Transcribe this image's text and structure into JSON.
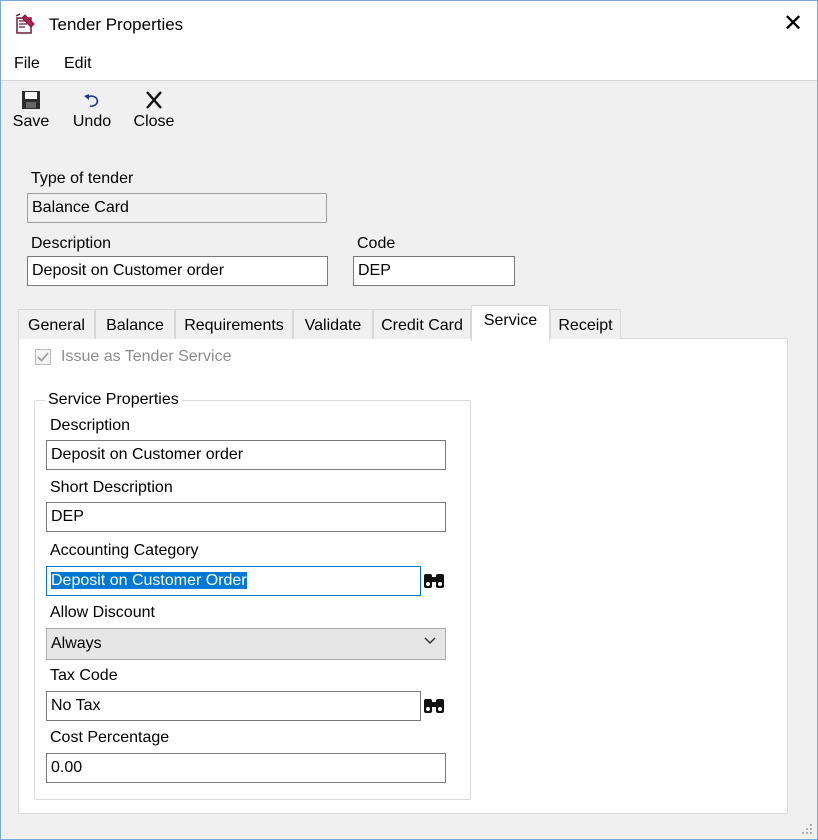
{
  "window": {
    "title": "Tender Properties"
  },
  "menu": {
    "file": "File",
    "edit": "Edit"
  },
  "toolbar": {
    "save": "Save",
    "undo": "Undo",
    "close": "Close"
  },
  "header": {
    "type_label": "Type of tender",
    "type_value": "Balance Card",
    "description_label": "Description",
    "description_value": "Deposit on Customer order",
    "code_label": "Code",
    "code_value": "DEP"
  },
  "tabs": [
    "General",
    "Balance",
    "Requirements",
    "Validate",
    "Credit Card",
    "Service",
    "Receipt"
  ],
  "active_tab": "Service",
  "service": {
    "issue_checkbox_label": "Issue as Tender Service",
    "issue_checked": true,
    "group_title": "Service Properties",
    "description_label": "Description",
    "description_value": "Deposit on Customer order",
    "short_description_label": "Short Description",
    "short_description_value": "DEP",
    "accounting_category_label": "Accounting Category",
    "accounting_category_value": "Deposit on Customer Order",
    "allow_discount_label": "Allow Discount",
    "allow_discount_value": "Always",
    "tax_code_label": "Tax Code",
    "tax_code_value": "No Tax",
    "cost_percentage_label": "Cost Percentage",
    "cost_percentage_value": "0.00"
  },
  "colors": {
    "selection": "#0078d7",
    "window_border": "#7aa7d9",
    "panel_bg": "#f0f0f0"
  }
}
